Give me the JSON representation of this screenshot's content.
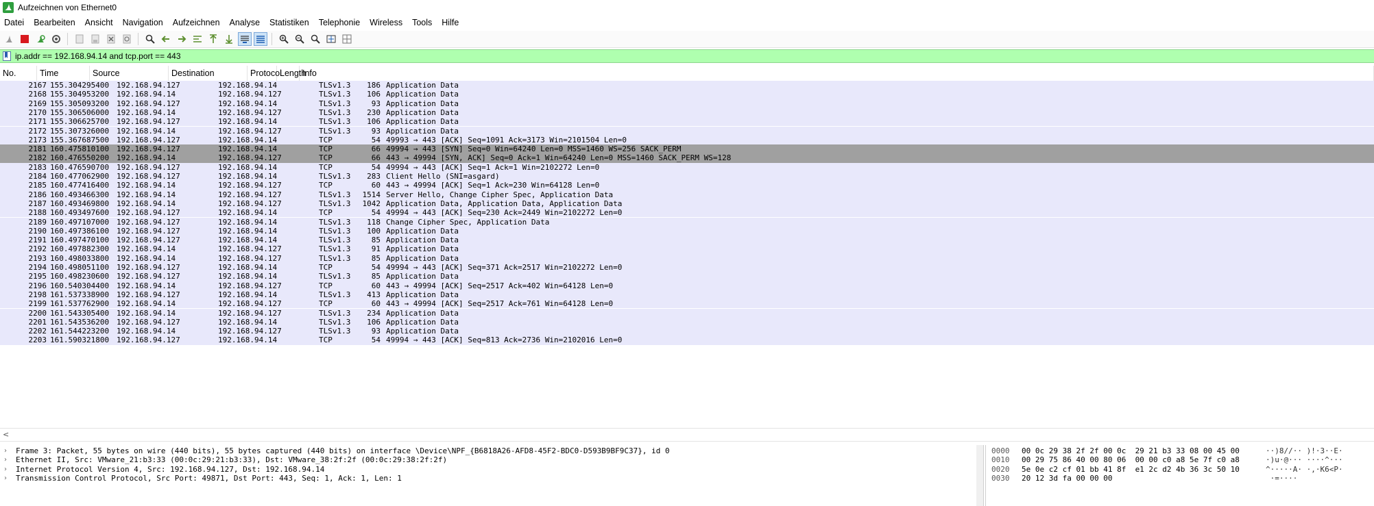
{
  "window": {
    "title": "Aufzeichnen von Ethernet0",
    "app_icon": "shark-fin-icon",
    "accent": "#2e9e3e"
  },
  "menu": [
    "Datei",
    "Bearbeiten",
    "Ansicht",
    "Navigation",
    "Aufzeichnen",
    "Analyse",
    "Statistiken",
    "Telephonie",
    "Wireless",
    "Tools",
    "Hilfe"
  ],
  "toolbar": {
    "icons": [
      "start-capture-icon",
      "stop-capture-icon",
      "restart-capture-icon",
      "capture-options-icon",
      "open-file-icon",
      "save-file-icon",
      "close-file-icon",
      "reload-file-icon",
      "find-packet-icon",
      "go-back-icon",
      "go-forward-icon",
      "go-to-packet-icon",
      "go-first-packet-icon",
      "go-last-packet-icon",
      "auto-scroll-icon",
      "colorize-icon",
      "zoom-in-icon",
      "zoom-out-icon",
      "normal-size-icon",
      "resize-columns-icon",
      "layout-icon"
    ]
  },
  "filter": {
    "value": "ip.addr == 192.168.94.14 and tcp.port == 443",
    "background": "#afffaf"
  },
  "packet_list": {
    "columns": [
      "No.",
      "Time",
      "Source",
      "Destination",
      "Protocol",
      "Length",
      "Info"
    ],
    "rows": [
      {
        "no": "2167",
        "time": "155.304295400",
        "src": "192.168.94.127",
        "dst": "192.168.94.14",
        "proto": "TLSv1.3",
        "len": "186",
        "info": "Application Data",
        "style": "normal"
      },
      {
        "no": "2168",
        "time": "155.304953200",
        "src": "192.168.94.14",
        "dst": "192.168.94.127",
        "proto": "TLSv1.3",
        "len": "106",
        "info": "Application Data",
        "style": "normal"
      },
      {
        "no": "2169",
        "time": "155.305093200",
        "src": "192.168.94.127",
        "dst": "192.168.94.14",
        "proto": "TLSv1.3",
        "len": "93",
        "info": "Application Data",
        "style": "normal"
      },
      {
        "no": "2170",
        "time": "155.306506000",
        "src": "192.168.94.14",
        "dst": "192.168.94.127",
        "proto": "TLSv1.3",
        "len": "230",
        "info": "Application Data",
        "style": "normal"
      },
      {
        "no": "2171",
        "time": "155.306625700",
        "src": "192.168.94.127",
        "dst": "192.168.94.14",
        "proto": "TLSv1.3",
        "len": "106",
        "info": "Application Data",
        "style": "normal"
      },
      {
        "no": "2172",
        "time": "155.307326000",
        "src": "192.168.94.14",
        "dst": "192.168.94.127",
        "proto": "TLSv1.3",
        "len": "93",
        "info": "Application Data",
        "style": "normal"
      },
      {
        "no": "2173",
        "time": "155.367687500",
        "src": "192.168.94.127",
        "dst": "192.168.94.14",
        "proto": "TCP",
        "len": "54",
        "info": "49993 → 443 [ACK] Seq=1091 Ack=3173 Win=2101504 Len=0",
        "style": "normal"
      },
      {
        "no": "2181",
        "time": "160.475810100",
        "src": "192.168.94.127",
        "dst": "192.168.94.14",
        "proto": "TCP",
        "len": "66",
        "info": "49994 → 443 [SYN] Seq=0 Win=64240 Len=0 MSS=1460 WS=256 SACK_PERM",
        "style": "syn"
      },
      {
        "no": "2182",
        "time": "160.476550200",
        "src": "192.168.94.14",
        "dst": "192.168.94.127",
        "proto": "TCP",
        "len": "66",
        "info": "443 → 49994 [SYN, ACK] Seq=0 Ack=1 Win=64240 Len=0 MSS=1460 SACK_PERM WS=128",
        "style": "syn"
      },
      {
        "no": "2183",
        "time": "160.476590700",
        "src": "192.168.94.127",
        "dst": "192.168.94.14",
        "proto": "TCP",
        "len": "54",
        "info": "49994 → 443 [ACK] Seq=1 Ack=1 Win=2102272 Len=0",
        "style": "normal"
      },
      {
        "no": "2184",
        "time": "160.477062900",
        "src": "192.168.94.127",
        "dst": "192.168.94.14",
        "proto": "TLSv1.3",
        "len": "283",
        "info": "Client Hello (SNI=asgard)",
        "style": "normal"
      },
      {
        "no": "2185",
        "time": "160.477416400",
        "src": "192.168.94.14",
        "dst": "192.168.94.127",
        "proto": "TCP",
        "len": "60",
        "info": "443 → 49994 [ACK] Seq=1 Ack=230 Win=64128 Len=0",
        "style": "normal"
      },
      {
        "no": "2186",
        "time": "160.493466300",
        "src": "192.168.94.14",
        "dst": "192.168.94.127",
        "proto": "TLSv1.3",
        "len": "1514",
        "info": "Server Hello, Change Cipher Spec, Application Data",
        "style": "normal"
      },
      {
        "no": "2187",
        "time": "160.493469800",
        "src": "192.168.94.14",
        "dst": "192.168.94.127",
        "proto": "TLSv1.3",
        "len": "1042",
        "info": "Application Data, Application Data, Application Data",
        "style": "normal"
      },
      {
        "no": "2188",
        "time": "160.493497600",
        "src": "192.168.94.127",
        "dst": "192.168.94.14",
        "proto": "TCP",
        "len": "54",
        "info": "49994 → 443 [ACK] Seq=230 Ack=2449 Win=2102272 Len=0",
        "style": "normal"
      },
      {
        "no": "2189",
        "time": "160.497107000",
        "src": "192.168.94.127",
        "dst": "192.168.94.14",
        "proto": "TLSv1.3",
        "len": "118",
        "info": "Change Cipher Spec, Application Data",
        "style": "normal"
      },
      {
        "no": "2190",
        "time": "160.497386100",
        "src": "192.168.94.127",
        "dst": "192.168.94.14",
        "proto": "TLSv1.3",
        "len": "100",
        "info": "Application Data",
        "style": "normal"
      },
      {
        "no": "2191",
        "time": "160.497470100",
        "src": "192.168.94.127",
        "dst": "192.168.94.14",
        "proto": "TLSv1.3",
        "len": "85",
        "info": "Application Data",
        "style": "normal"
      },
      {
        "no": "2192",
        "time": "160.497882300",
        "src": "192.168.94.14",
        "dst": "192.168.94.127",
        "proto": "TLSv1.3",
        "len": "91",
        "info": "Application Data",
        "style": "normal"
      },
      {
        "no": "2193",
        "time": "160.498033800",
        "src": "192.168.94.14",
        "dst": "192.168.94.127",
        "proto": "TLSv1.3",
        "len": "85",
        "info": "Application Data",
        "style": "normal"
      },
      {
        "no": "2194",
        "time": "160.498051100",
        "src": "192.168.94.127",
        "dst": "192.168.94.14",
        "proto": "TCP",
        "len": "54",
        "info": "49994 → 443 [ACK] Seq=371 Ack=2517 Win=2102272 Len=0",
        "style": "normal"
      },
      {
        "no": "2195",
        "time": "160.498230600",
        "src": "192.168.94.127",
        "dst": "192.168.94.14",
        "proto": "TLSv1.3",
        "len": "85",
        "info": "Application Data",
        "style": "normal"
      },
      {
        "no": "2196",
        "time": "160.540304400",
        "src": "192.168.94.14",
        "dst": "192.168.94.127",
        "proto": "TCP",
        "len": "60",
        "info": "443 → 49994 [ACK] Seq=2517 Ack=402 Win=64128 Len=0",
        "style": "normal"
      },
      {
        "no": "2198",
        "time": "161.537338900",
        "src": "192.168.94.127",
        "dst": "192.168.94.14",
        "proto": "TLSv1.3",
        "len": "413",
        "info": "Application Data",
        "style": "normal"
      },
      {
        "no": "2199",
        "time": "161.537762900",
        "src": "192.168.94.14",
        "dst": "192.168.94.127",
        "proto": "TCP",
        "len": "60",
        "info": "443 → 49994 [ACK] Seq=2517 Ack=761 Win=64128 Len=0",
        "style": "normal"
      },
      {
        "no": "2200",
        "time": "161.543305400",
        "src": "192.168.94.14",
        "dst": "192.168.94.127",
        "proto": "TLSv1.3",
        "len": "234",
        "info": "Application Data",
        "style": "normal"
      },
      {
        "no": "2201",
        "time": "161.543536200",
        "src": "192.168.94.127",
        "dst": "192.168.94.14",
        "proto": "TLSv1.3",
        "len": "106",
        "info": "Application Data",
        "style": "normal"
      },
      {
        "no": "2202",
        "time": "161.544223200",
        "src": "192.168.94.14",
        "dst": "192.168.94.127",
        "proto": "TLSv1.3",
        "len": "93",
        "info": "Application Data",
        "style": "normal"
      },
      {
        "no": "2203",
        "time": "161.590321800",
        "src": "192.168.94.127",
        "dst": "192.168.94.14",
        "proto": "TCP",
        "len": "54",
        "info": "49994 → 443 [ACK] Seq=813 Ack=2736 Win=2102016 Len=0",
        "style": "normal"
      }
    ],
    "row_colors": {
      "normal": "#e8e8fb",
      "syn": "#a0a0a0"
    }
  },
  "details": [
    "Frame 3: Packet, 55 bytes on wire (440 bits), 55 bytes captured (440 bits) on interface \\Device\\NPF_{B6818A26-AFD8-45F2-BDC0-D593B9BF9C37}, id 0",
    "Ethernet II, Src: VMware_21:b3:33 (00:0c:29:21:b3:33), Dst: VMware_38:2f:2f (00:0c:29:38:2f:2f)",
    "Internet Protocol Version 4, Src: 192.168.94.127, Dst: 192.168.94.14",
    "Transmission Control Protocol, Src Port: 49871, Dst Port: 443, Seq: 1, Ack: 1, Len: 1"
  ],
  "hex": [
    {
      "off": "0000",
      "hex": "00 0c 29 38 2f 2f 00 0c  29 21 b3 33 08 00 45 00",
      "ascii": "··)8//·· )!·3··E·"
    },
    {
      "off": "0010",
      "hex": "00 29 75 86 40 00 80 06  00 00 c0 a8 5e 7f c0 a8",
      "ascii": "·)u·@··· ····^···"
    },
    {
      "off": "0020",
      "hex": "5e 0e c2 cf 01 bb 41 8f  e1 2c d2 4b 36 3c 50 10",
      "ascii": "^·····A· ·,·K6<P·"
    },
    {
      "off": "0030",
      "hex": "20 12 3d fa 00 00 00",
      "ascii": " ·=····"
    }
  ]
}
